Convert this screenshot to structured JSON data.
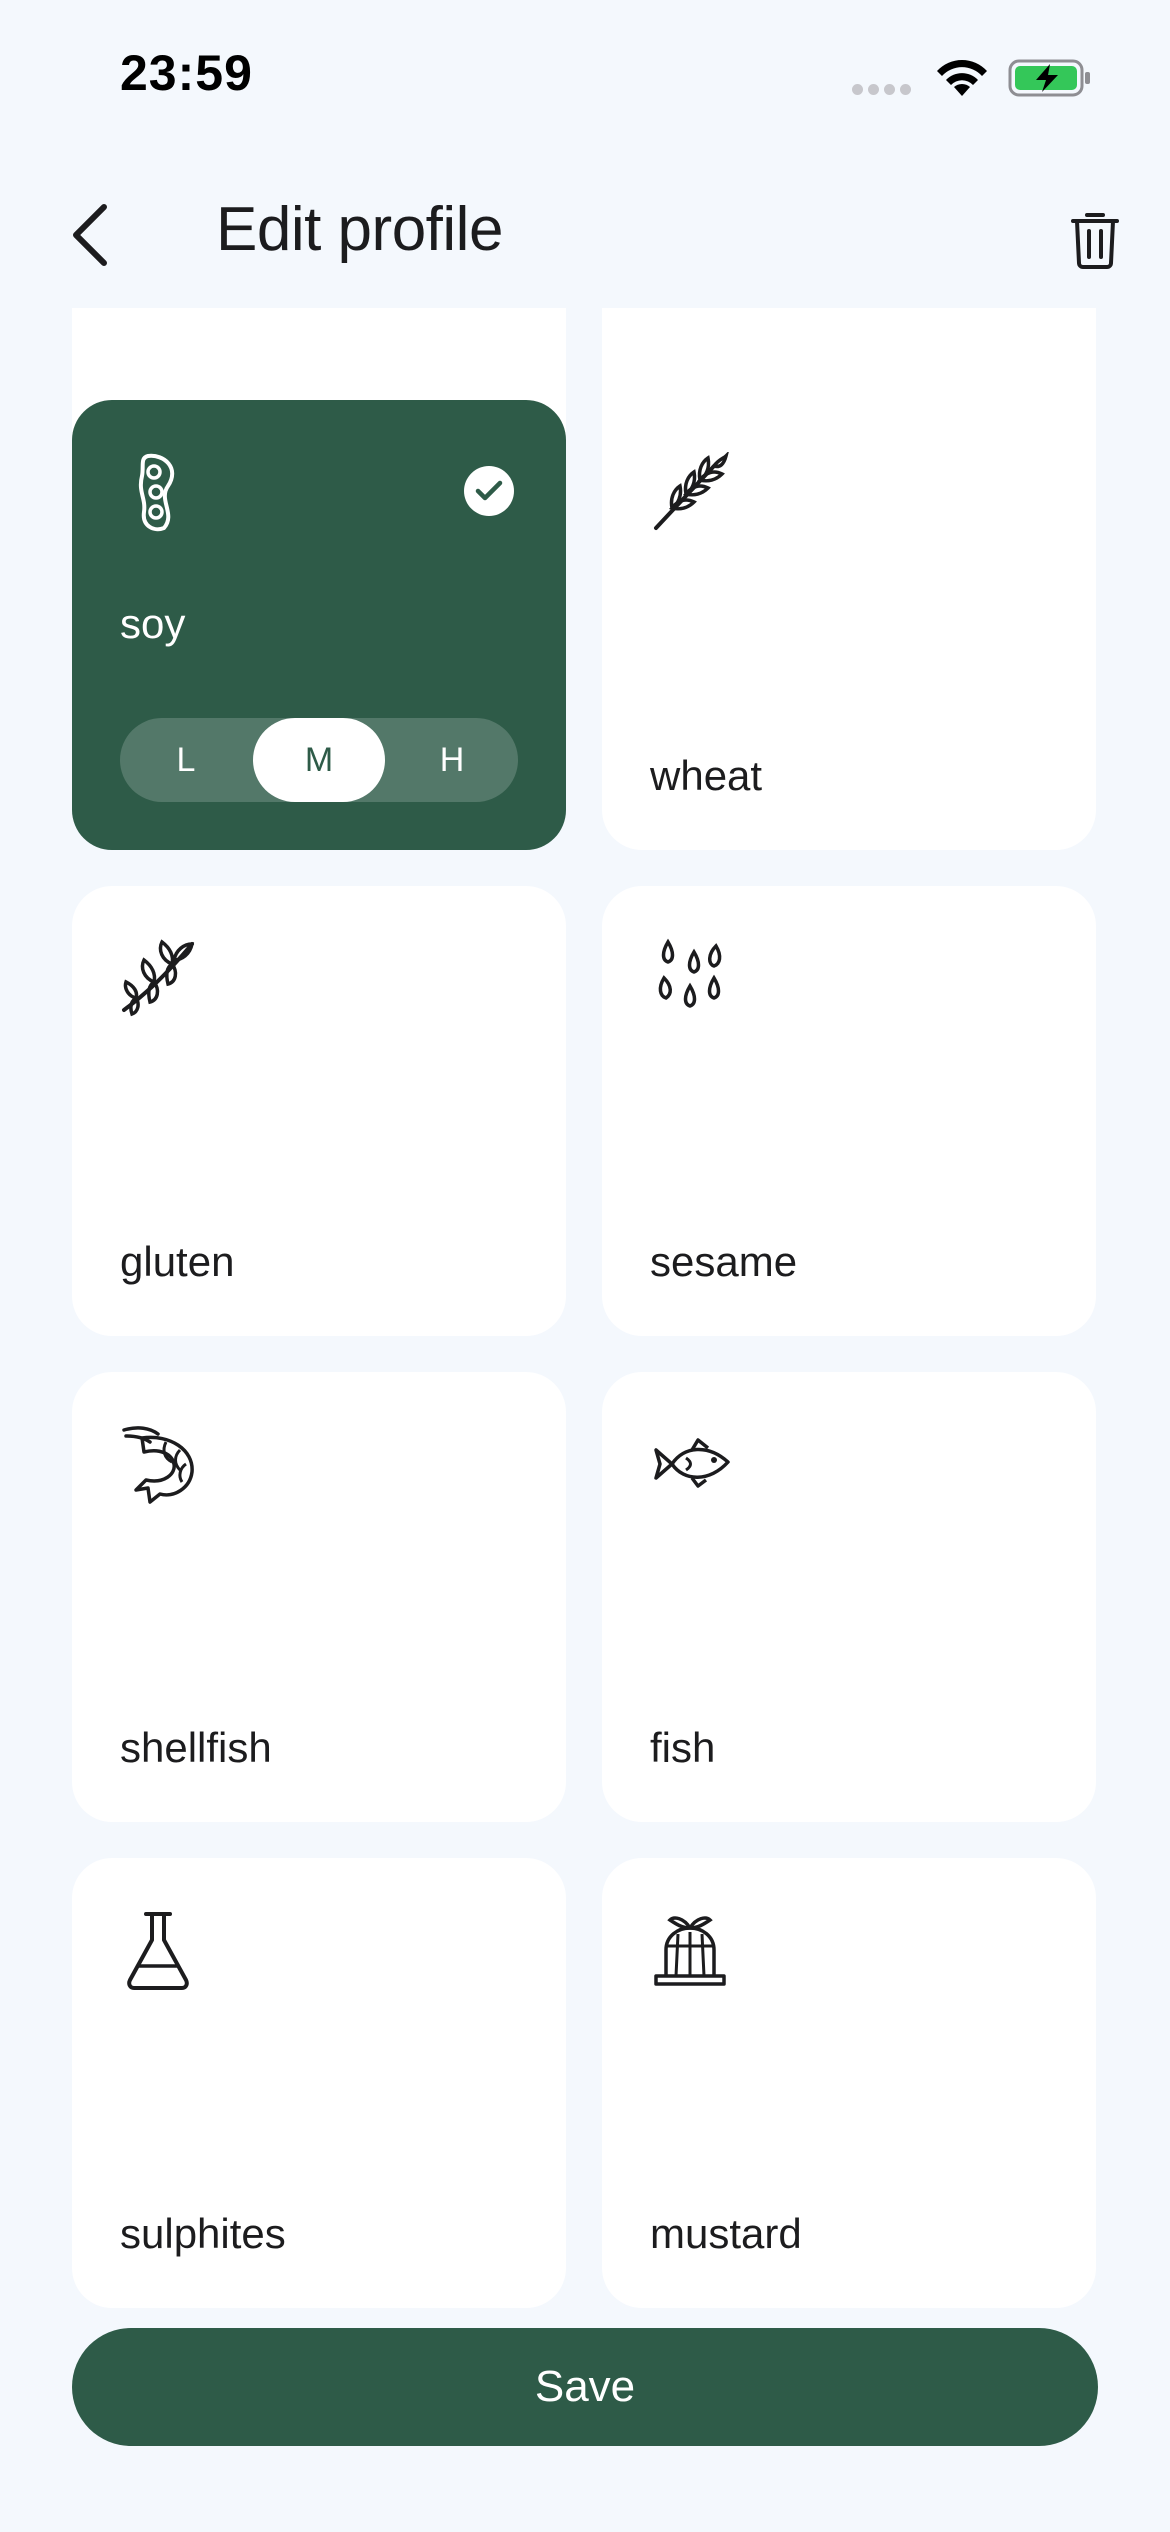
{
  "status_bar": {
    "time": "23:59"
  },
  "header": {
    "title": "Edit profile"
  },
  "grid": {
    "cards": [
      {
        "label": "",
        "icon": "partial-card",
        "selected": false
      },
      {
        "label": "",
        "icon": "egg-icon",
        "selected": false
      },
      {
        "label": "soy",
        "icon": "soybean-icon",
        "selected": true,
        "severity": {
          "options": [
            "L",
            "M",
            "H"
          ],
          "selected": "M"
        }
      },
      {
        "label": "wheat",
        "icon": "wheat-icon",
        "selected": false
      },
      {
        "label": "gluten",
        "icon": "grain-icon",
        "selected": false
      },
      {
        "label": "sesame",
        "icon": "sesame-seeds-icon",
        "selected": false
      },
      {
        "label": "shellfish",
        "icon": "shrimp-icon",
        "selected": false
      },
      {
        "label": "fish",
        "icon": "fish-icon",
        "selected": false
      },
      {
        "label": "sulphites",
        "icon": "flask-icon",
        "selected": false
      },
      {
        "label": "mustard",
        "icon": "mustard-jelly-icon",
        "selected": false
      }
    ]
  },
  "footer": {
    "save_label": "Save"
  },
  "colors": {
    "accent": "#2e5b48",
    "background": "#f4f8fd",
    "card": "#ffffff",
    "battery": "#34c759"
  }
}
